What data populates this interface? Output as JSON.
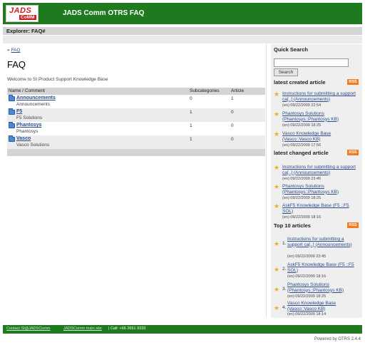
{
  "header": {
    "logo_top": "JADS",
    "logo_bottom": "CoMM",
    "title": "JADS Comm OTRS FAQ"
  },
  "explorer": {
    "label": "Explorer: FAQ#"
  },
  "breadcrumb": {
    "separator": "»",
    "link": "FAQ"
  },
  "page": {
    "title": "FAQ",
    "welcome": "Welcome to SI Product Support Knowledge Base"
  },
  "table": {
    "headers": {
      "name": "Name / Comment",
      "subcategories": "Subcategories",
      "article": "Article"
    },
    "rows": [
      {
        "name": "Announcements",
        "comment": "Announcements",
        "subcategories": "0",
        "article": "1"
      },
      {
        "name": "F5",
        "comment": "F5 Solutions",
        "subcategories": "1",
        "article": "0"
      },
      {
        "name": "Phantosys",
        "comment": "Phantosys",
        "subcategories": "1",
        "article": "0"
      },
      {
        "name": "Vasco",
        "comment": "Vasco Solutions",
        "subcategories": "1",
        "article": "0"
      }
    ]
  },
  "sidebar": {
    "quick_search": "Quick Search",
    "search_button": "Search",
    "rss_label": "RSS",
    "latest_created": {
      "heading": "latest created article",
      "items": [
        {
          "title": "Instructions for submitting a support ca[..] (Announcements)",
          "meta": "(en) 09/22/2009 22:54"
        },
        {
          "title": "Phantosys Solutions (Phantosys::Phantosys KB)",
          "meta": "(en) 09/22/2009 18:25"
        },
        {
          "title": "Vasco Knowledge Base (Vasco::Vasco KB)",
          "meta": "(en) 09/22/2009 17:56"
        }
      ]
    },
    "latest_changed": {
      "heading": "latest changed article",
      "items": [
        {
          "title": "Instructions for submitting a support ca[..] (Announcements)",
          "meta": "(en) 09/22/2009 23:45"
        },
        {
          "title": "Phantosys Solutions (Phantosys::Phantosys KB)",
          "meta": "(en) 09/22/2009 18:25"
        },
        {
          "title": "AskF5 Knowledge Base (F5 ::F5 SOL)",
          "meta": "(en) 09/22/2009 18:16"
        }
      ]
    },
    "top10": {
      "heading": "Top 10 articles",
      "items": [
        {
          "num": "1.",
          "title": "Instructions for submitting a support ca[..] (Announcements)",
          "meta": "(en) 09/22/2009 23:45"
        },
        {
          "num": "2.",
          "title": "AskF5 Knowledge Base (F5 ::F5 SOL)",
          "meta": "(en) 09/22/2009 18:16"
        },
        {
          "num": "3.",
          "title": "Phantosys Solutions (Phantosys::Phantosys KB)",
          "meta": "(en) 09/22/2009 18:25"
        },
        {
          "num": "4.",
          "title": "Vasco Knowledge Base (Vasco::Vasco KB)",
          "meta": "(en) 09/22/2009 18:14"
        }
      ]
    }
  },
  "footer": {
    "contact": "Contact SI@JADSComm",
    "main_site": "JADSComm main site",
    "call": "| Call: +66 2651 9333",
    "powered": "Powered by OTRS 2.4.4"
  },
  "colors": {
    "brand_green": "#1f7a1f",
    "rss_orange": "#f27a1f",
    "star_gold": "#e8b21a",
    "link_blue": "#2b4b8c"
  }
}
